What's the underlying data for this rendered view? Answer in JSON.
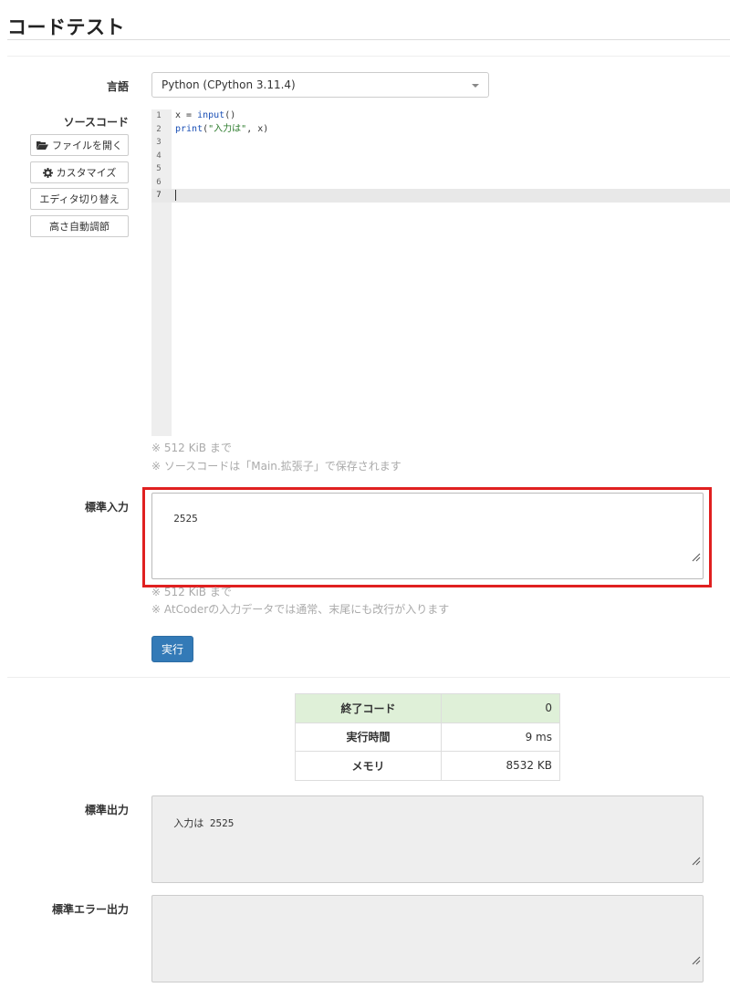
{
  "page": {
    "title": "コードテスト"
  },
  "language": {
    "label": "言語",
    "selected": "Python (CPython 3.11.4)"
  },
  "source": {
    "label": "ソースコード",
    "buttons": {
      "open_file": "ファイルを開く",
      "customize": "カスタマイズ",
      "switch_editor": "エディタ切り替え",
      "auto_height": "高さ自動調節"
    },
    "lines": [
      {
        "no": "1",
        "text": "x = input()"
      },
      {
        "no": "2",
        "text": "print(\"入力は\", x)"
      },
      {
        "no": "3",
        "text": ""
      },
      {
        "no": "4",
        "text": ""
      },
      {
        "no": "5",
        "text": ""
      },
      {
        "no": "6",
        "text": ""
      },
      {
        "no": "7",
        "text": ""
      }
    ],
    "help_size": "※ 512 KiB まで",
    "help_save": "※ ソースコードは「Main.拡張子」で保存されます"
  },
  "stdin": {
    "label": "標準入力",
    "value": "2525",
    "help_size": "※ 512 KiB まで",
    "help_newline": "※ AtCoderの入力データでは通常、末尾にも改行が入ります"
  },
  "run_label": "実行",
  "result": {
    "rows": [
      {
        "key": "終了コード",
        "value": "0"
      },
      {
        "key": "実行時間",
        "value": "9 ms"
      },
      {
        "key": "メモリ",
        "value": "8532 KB"
      }
    ]
  },
  "stdout": {
    "label": "標準出力",
    "value": "入力は 2525"
  },
  "stderr": {
    "label": "標準エラー出力",
    "value": ""
  },
  "colors": {
    "primary": "#337ab7",
    "success_bg": "#dff0d8",
    "highlight": "#e02020"
  },
  "icons": [
    "folder-open-icon",
    "gear-icon",
    "resize-handle-icon",
    "dropdown-caret-icon"
  ]
}
